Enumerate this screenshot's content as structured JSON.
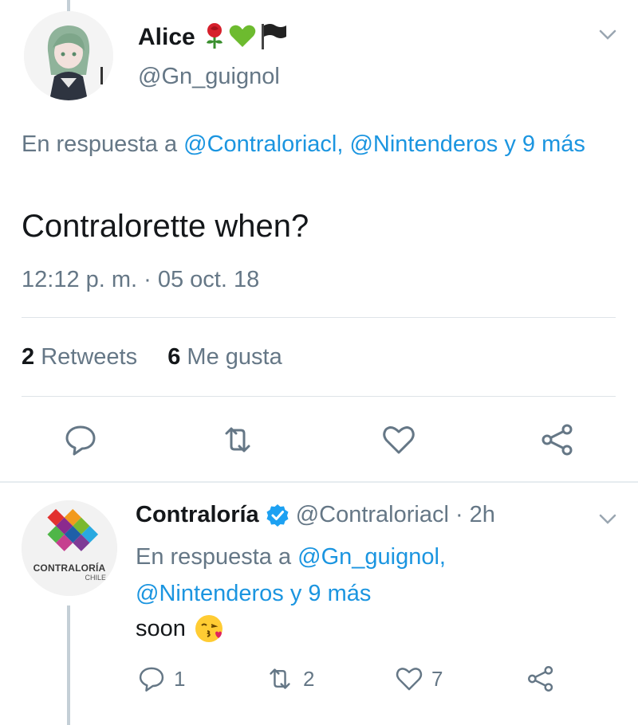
{
  "tweet1": {
    "author_name": "Alice",
    "author_emojis": [
      "rose-emoji",
      "green-heart-emoji",
      "black-flag-emoji"
    ],
    "handle": "@Gn_guignol",
    "reply_prefix": "En respuesta a ",
    "reply_targets": "@Contraloriacl, @Nintenderos y 9 más",
    "text": "Contralorette when?",
    "timestamp": "12:12 p. m. · 05 oct. 18",
    "retweet_count": "2",
    "retweet_label": "Retweets",
    "like_count": "6",
    "like_label": "Me gusta"
  },
  "tweet2": {
    "author_name": "Contraloría",
    "handle_time": "@Contraloriacl · 2h",
    "reply_prefix": "En respuesta a ",
    "reply_target_1": "@Gn_guignol,",
    "reply_target_2": "@Nintenderos y 9 más",
    "text": "soon",
    "reply_count": "1",
    "retweet_count": "2",
    "like_count": "7",
    "avatar_logo_text": "CONTRALORÍA",
    "avatar_logo_sub": "CHILE"
  },
  "colors": {
    "link": "#1b95e0",
    "secondary": "#657786",
    "verified": "#1da1f2"
  }
}
